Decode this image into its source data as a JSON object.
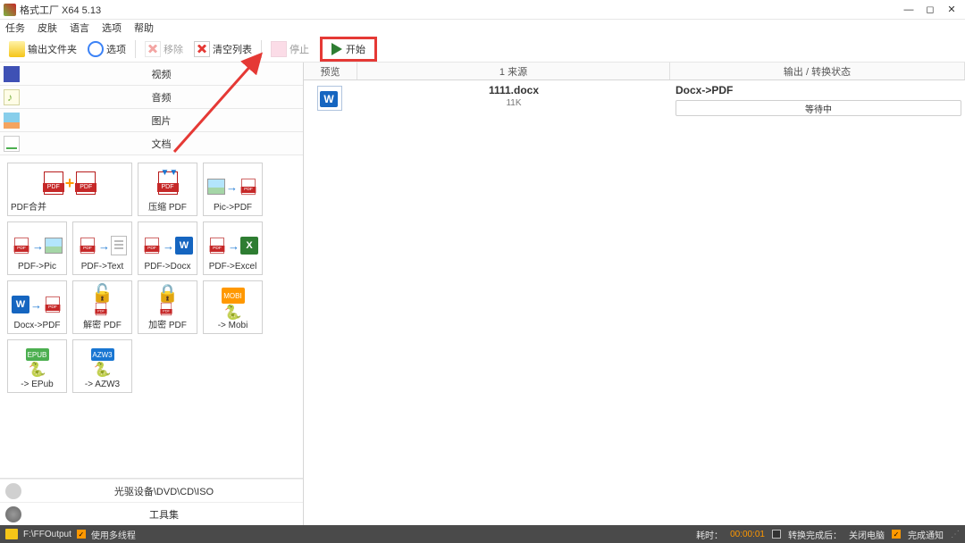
{
  "title": "格式工厂 X64 5.13",
  "menu": {
    "task": "任务",
    "skin": "皮肤",
    "lang": "语言",
    "option": "选项",
    "help": "帮助"
  },
  "toolbar": {
    "output": "输出文件夹",
    "option": "选项",
    "remove": "移除",
    "clear": "清空列表",
    "stop": "停止",
    "start": "开始"
  },
  "categories": {
    "video": "视频",
    "audio": "音频",
    "image": "图片",
    "doc": "文档"
  },
  "tiles": {
    "pdf_merge": "PDF合并",
    "compress_pdf": "压缩 PDF",
    "pic_pdf": "Pic->PDF",
    "pdf_pic": "PDF->Pic",
    "pdf_text": "PDF->Text",
    "pdf_docx": "PDF->Docx",
    "pdf_excel": "PDF->Excel",
    "docx_pdf": "Docx->PDF",
    "decrypt_pdf": "解密 PDF",
    "encrypt_pdf": "加密 PDF",
    "mobi": "-> Mobi",
    "epub": "-> EPub",
    "azw3": "-> AZW3"
  },
  "bottom": {
    "optical": "光驱设备\\DVD\\CD\\ISO",
    "toolbox": "工具集"
  },
  "list": {
    "hdr_preview": "预览",
    "hdr_source": "1 来源",
    "hdr_output": "输出 / 转换状态",
    "fname": "1111.docx",
    "fsize": "11K",
    "out": "Docx->PDF",
    "status": "等待中"
  },
  "status": {
    "output_path": "F:\\FFOutput",
    "multithread": "使用多线程",
    "elapsed_lbl": "耗时：",
    "elapsed": "00:00:01",
    "after_lbl": "转换完成后：",
    "shutdown": "关闭电脑",
    "notify": "完成通知"
  }
}
